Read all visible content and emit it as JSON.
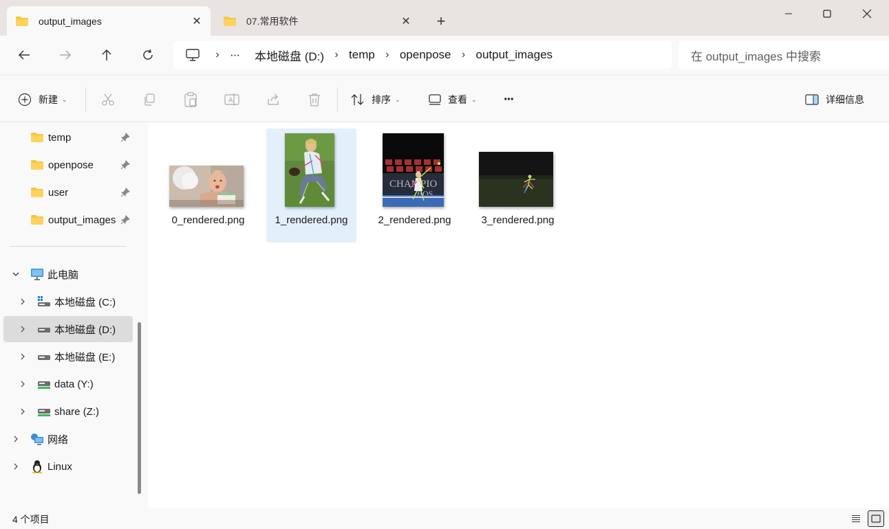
{
  "tabs": [
    {
      "label": "output_images",
      "active": true
    },
    {
      "label": "07.常用软件",
      "active": false
    }
  ],
  "window": {
    "minimize": "minimize",
    "maximize": "maximize",
    "close": "close"
  },
  "breadcrumb": {
    "more": "···",
    "items": [
      "本地磁盘 (D:)",
      "temp",
      "openpose",
      "output_images"
    ]
  },
  "search": {
    "placeholder": "在 output_images 中搜索"
  },
  "toolbar": {
    "new_label": "新建",
    "sort_label": "排序",
    "view_label": "查看",
    "more_label": "···",
    "details_label": "详细信息"
  },
  "sidebar": {
    "quick_access": [
      {
        "label": "temp",
        "pinned": true
      },
      {
        "label": "openpose",
        "pinned": true
      },
      {
        "label": "user",
        "pinned": true
      },
      {
        "label": "output_images",
        "pinned": true
      }
    ],
    "this_pc": "此电脑",
    "drives": [
      {
        "label": "本地磁盘 (C:)",
        "selected": false
      },
      {
        "label": "本地磁盘 (D:)",
        "selected": true
      },
      {
        "label": "本地磁盘 (E:)",
        "selected": false
      },
      {
        "label": "data (Y:)",
        "selected": false
      },
      {
        "label": "share (Z:)",
        "selected": false
      }
    ],
    "network": "网络",
    "linux": "Linux"
  },
  "files": [
    {
      "name": "0_rendered.png",
      "selected": false
    },
    {
      "name": "1_rendered.png",
      "selected": true
    },
    {
      "name": "2_rendered.png",
      "selected": false
    },
    {
      "name": "3_rendered.png",
      "selected": false
    }
  ],
  "status": {
    "count": "4 个项目"
  },
  "colors": {
    "accent": "#0067c0",
    "folder": "#f7c444",
    "selected_file": "#e3f0fc"
  }
}
